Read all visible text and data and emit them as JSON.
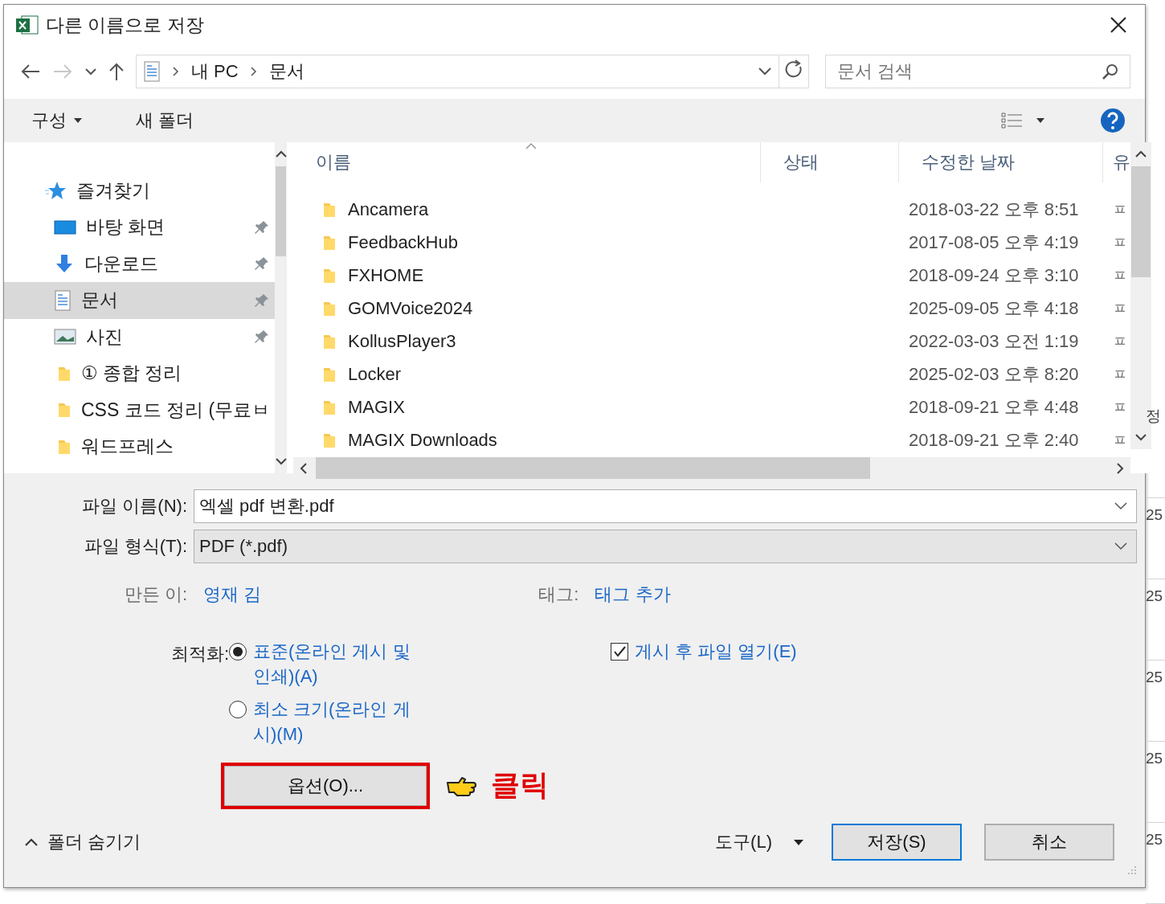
{
  "window": {
    "title": "다른 이름으로 저장"
  },
  "address_bar": {
    "path": [
      "내 PC",
      "문서"
    ]
  },
  "search": {
    "placeholder": "문서 검색"
  },
  "toolbar": {
    "organize": "구성",
    "new_folder": "새 폴더"
  },
  "nav": {
    "items": [
      {
        "label": "즐겨찾기",
        "kind": "star",
        "pinned": false,
        "selected": false,
        "children": [
          {
            "label": "바탕 화면",
            "kind": "desktop",
            "pinned": true,
            "selected": false
          },
          {
            "label": "다운로드",
            "kind": "download",
            "pinned": true,
            "selected": false
          },
          {
            "label": "문서",
            "kind": "document",
            "pinned": true,
            "selected": true
          },
          {
            "label": "사진",
            "kind": "pictures",
            "pinned": true,
            "selected": false
          },
          {
            "label": "① 종합 정리",
            "kind": "folder",
            "pinned": false,
            "selected": false
          },
          {
            "label": "CSS 코드 정리 (무료ㅂ",
            "kind": "folder",
            "pinned": false,
            "selected": false
          },
          {
            "label": "워드프레스",
            "kind": "folder",
            "pinned": false,
            "selected": false
          }
        ]
      }
    ]
  },
  "file_list": {
    "columns": [
      "이름",
      "상태",
      "수정한 날짜",
      "유"
    ],
    "rows": [
      {
        "name": "Ancamera",
        "modified": "2018-03-22 오후 8:51",
        "type": "ㅍ"
      },
      {
        "name": "FeedbackHub",
        "modified": "2017-08-05 오후 4:19",
        "type": "ㅍ"
      },
      {
        "name": "FXHOME",
        "modified": "2018-09-24 오후 3:10",
        "type": "ㅍ"
      },
      {
        "name": "GOMVoice2024",
        "modified": "2025-09-05 오후 4:18",
        "type": "ㅍ"
      },
      {
        "name": "KollusPlayer3",
        "modified": "2022-03-03 오전 1:19",
        "type": "ㅍ"
      },
      {
        "name": "Locker",
        "modified": "2025-02-03 오후 8:20",
        "type": "ㅍ"
      },
      {
        "name": "MAGIX",
        "modified": "2018-09-21 오후 4:48",
        "type": "ㅍ"
      },
      {
        "name": "MAGIX Downloads",
        "modified": "2018-09-21 오후 2:40",
        "type": "ㅍ"
      }
    ]
  },
  "form": {
    "file_name": {
      "label": "파일 이름(N):",
      "value": "엑셀 pdf 변환.pdf"
    },
    "file_type": {
      "label": "파일 형식(T):",
      "value": "PDF (*.pdf)"
    },
    "author": {
      "label": "만든 이:",
      "value": "영재 김"
    },
    "tags": {
      "label": "태그:",
      "value": "태그 추가"
    },
    "optimize": {
      "label": "최적화:",
      "options": [
        {
          "label": "표준(온라인 게시 및 인쇄)(A)",
          "selected": true
        },
        {
          "label": "최소 크기(온라인 게시)(M)",
          "selected": false
        }
      ]
    },
    "open_after": {
      "label": "게시 후 파일 열기(E)",
      "checked": true
    },
    "options_button": {
      "label": "옵션(O)...",
      "highlighted": true
    }
  },
  "annotation": {
    "text": "클릭"
  },
  "footer": {
    "hide_folders": "폴더 숨기기",
    "tools": "도구(L)",
    "save": "저장(S)",
    "cancel": "취소"
  },
  "background_sheet": {
    "cells": [
      "정",
      "25",
      "25",
      "25",
      "25",
      "25"
    ]
  }
}
